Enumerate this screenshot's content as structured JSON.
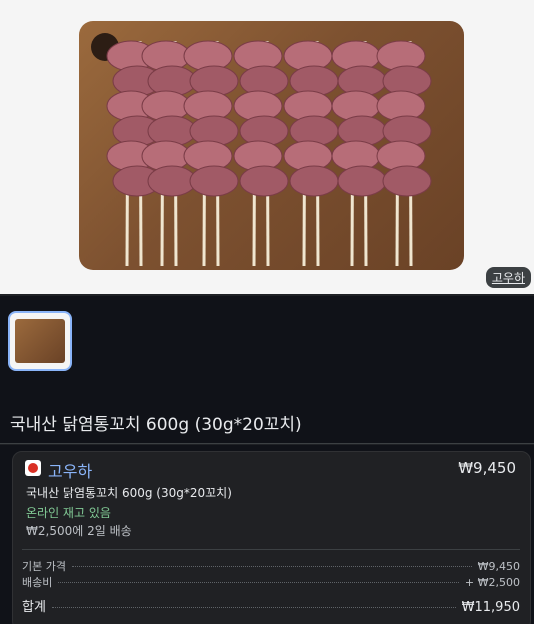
{
  "hero": {
    "source_badge": "고우하"
  },
  "product": {
    "title": "국내산 닭염통꼬치 600g (30g*20꼬치)"
  },
  "offer": {
    "seller_name": "고우하",
    "price": "₩9,450",
    "product_name": "국내산 닭염통꼬치 600g (30g*20꼬치)",
    "stock": "온라인 재고 있음",
    "shipping": "₩2,500에 2일 배송",
    "breakdown": {
      "base_label": "기본 가격",
      "base_value": "₩9,450",
      "ship_label": "배송비",
      "ship_value": "+ ₩2,500",
      "total_label": "합계",
      "total_value": "₩11,950"
    }
  },
  "colors": {
    "accent": "#8ab4f8",
    "in_stock": "#81c995",
    "background": "#101218"
  }
}
